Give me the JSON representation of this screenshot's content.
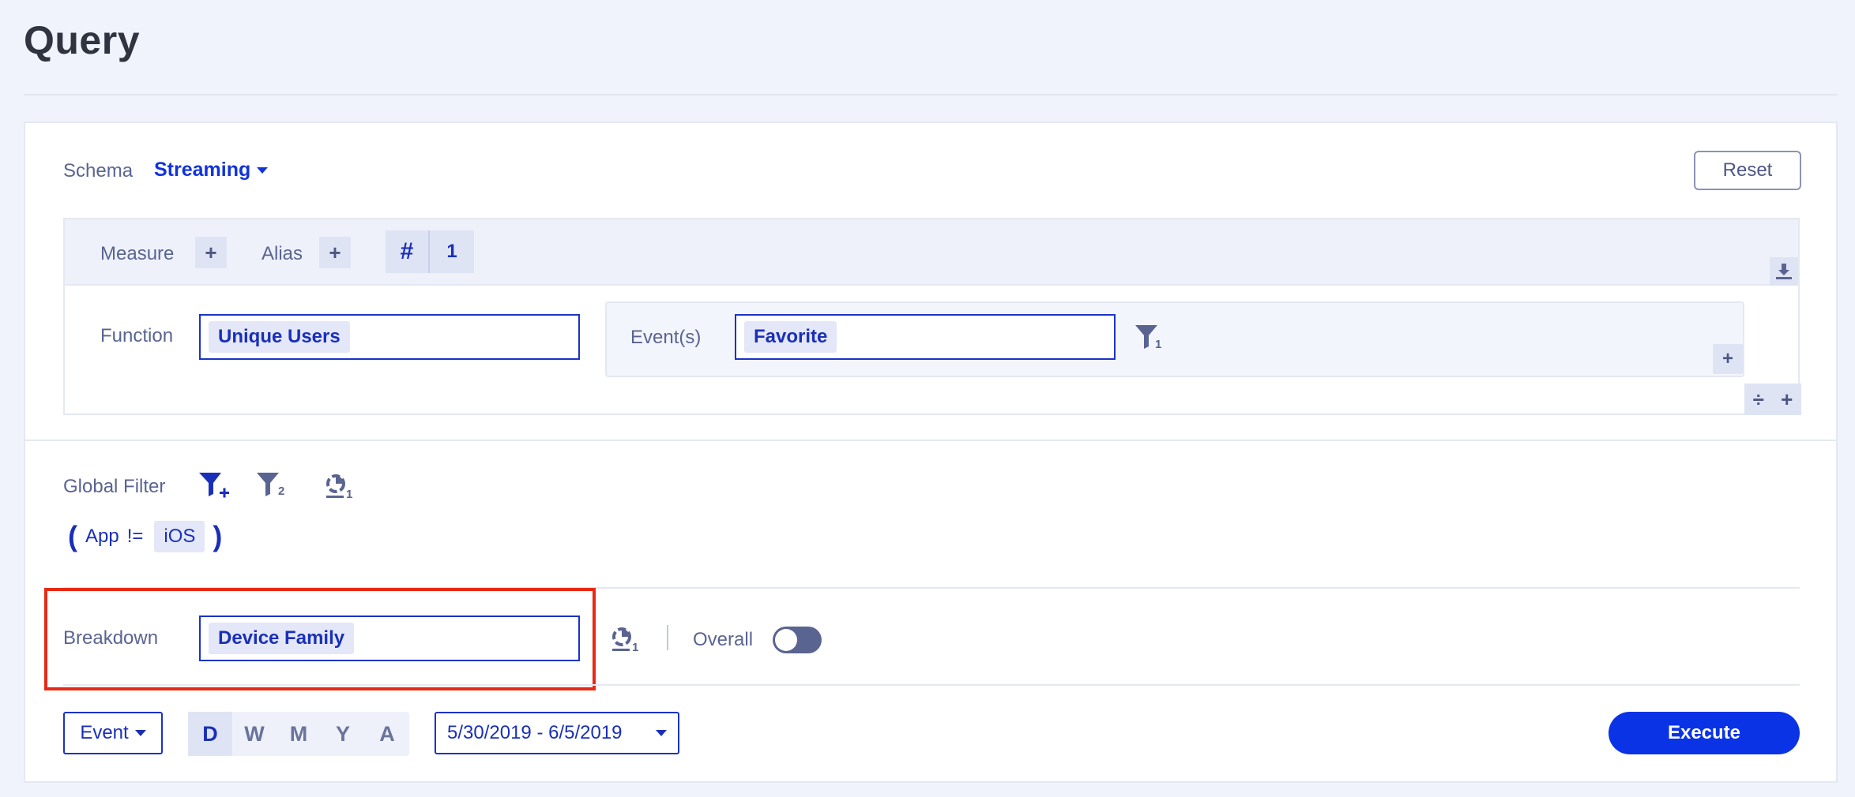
{
  "page": {
    "title": "Query"
  },
  "schema": {
    "label": "Schema",
    "value": "Streaming"
  },
  "reset_label": "Reset",
  "measure": {
    "measure_label": "Measure",
    "alias_label": "Alias",
    "hash_symbol": "#",
    "count": "1",
    "function_label": "Function",
    "function_value": "Unique Users",
    "events_label": "Event(s)",
    "event_value": "Favorite",
    "event_filter_count": "1",
    "add_symbol": "+",
    "divide_symbol": "÷"
  },
  "global_filter": {
    "label": "Global Filter",
    "filter_count": "2",
    "segment_count": "1",
    "open_paren": "(",
    "field": "App",
    "operator": "!=",
    "value": "iOS",
    "close_paren": ")"
  },
  "breakdown": {
    "label": "Breakdown",
    "value": "Device Family",
    "segment_count": "1",
    "overall_label": "Overall",
    "overall_on": false
  },
  "footer": {
    "event_dropdown": "Event",
    "intervals": [
      "D",
      "W",
      "M",
      "Y",
      "A"
    ],
    "active_interval": "D",
    "date_range": "5/30/2019 - 6/5/2019",
    "execute_label": "Execute"
  },
  "colors": {
    "accent": "#0a33e6",
    "highlight": "#e62a15",
    "muted": "#5a6491"
  }
}
